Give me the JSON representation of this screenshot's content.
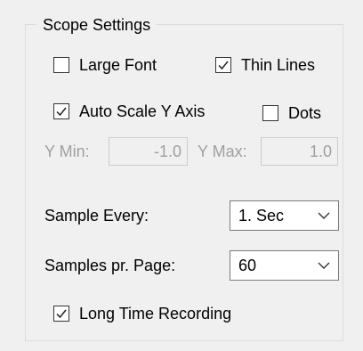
{
  "group": {
    "title": "Scope Settings"
  },
  "checkboxes": {
    "large_font": {
      "label": "Large Font",
      "checked": false
    },
    "thin_lines": {
      "label": "Thin Lines",
      "checked": true
    },
    "auto_scale": {
      "label": "Auto Scale Y Axis",
      "checked": true
    },
    "dots": {
      "label": "Dots",
      "checked": false
    },
    "long_time": {
      "label": "Long Time Recording",
      "checked": true
    }
  },
  "y_range": {
    "min_label": "Y Min:",
    "min_value": "-1.0",
    "max_label": "Y Max:",
    "max_value": "1.0"
  },
  "sample_every": {
    "label": "Sample Every:",
    "selected": "1. Sec"
  },
  "samples_per_page": {
    "label": "Samples pr. Page:",
    "selected": "60"
  },
  "icons": {
    "check": "check-mark-icon",
    "dropdown": "chevron-down-icon"
  },
  "colors": {
    "background": "#f0f0f0",
    "border": "#dcdcdc",
    "disabled_text": "#a0a0a0"
  }
}
